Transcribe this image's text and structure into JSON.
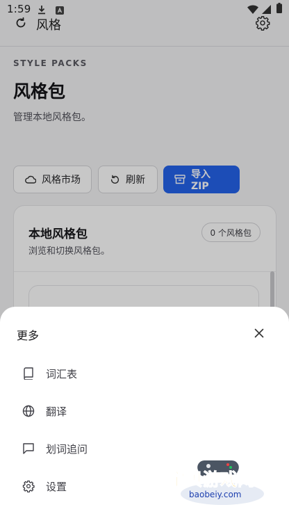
{
  "status_bar": {
    "time": "1:59"
  },
  "app_bar": {
    "title": "风格",
    "refresh_icon": "refresh-icon",
    "settings_icon": "gear-icon"
  },
  "page": {
    "eyebrow": "STYLE PACKS",
    "title": "风格包",
    "subtitle": "管理本地风格包。"
  },
  "actions": {
    "market": "风格市场",
    "refresh": "刷新",
    "import_zip": "导入 ZIP"
  },
  "card": {
    "title": "本地风格包",
    "subtitle": "浏览和切换风格包。",
    "count_badge": "0 个风格包"
  },
  "sheet": {
    "title": "更多",
    "items": [
      {
        "label": "词汇表",
        "icon": "book-icon"
      },
      {
        "label": "翻译",
        "icon": "globe-icon"
      },
      {
        "label": "划词追问",
        "icon": "chat-bubble-icon"
      },
      {
        "label": "设置",
        "icon": "gear-icon"
      }
    ]
  },
  "watermark": {
    "main": "宝贝游戏网",
    "url": "baobeiy.com"
  },
  "colors": {
    "primary": "#2563eb",
    "scrim": "rgba(0,0,0,0.22)",
    "watermark": "#f5b301"
  }
}
